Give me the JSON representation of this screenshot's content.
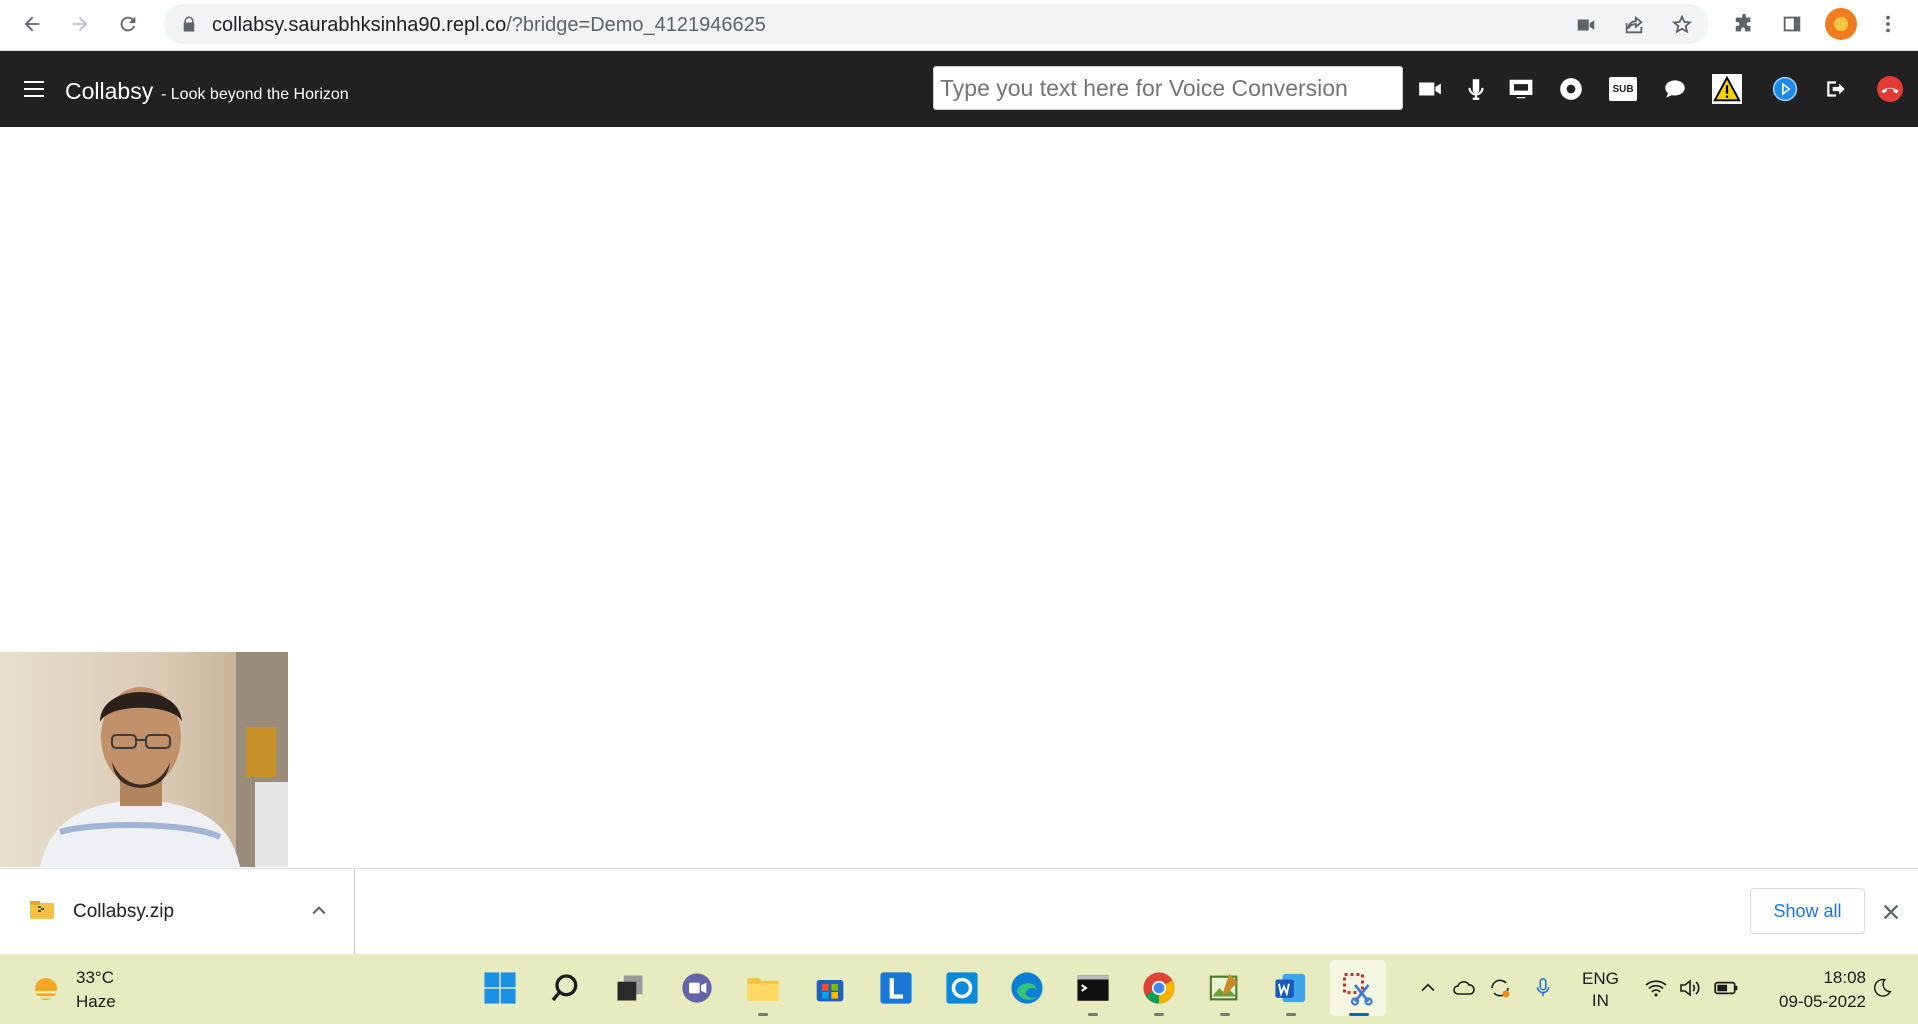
{
  "browser": {
    "url_host": "collabsy.saurabhksinha90.repl.co",
    "url_path": "/?bridge=Demo_4121946625"
  },
  "app": {
    "brand": "Collabsy",
    "tagline": "- Look beyond the Horizon",
    "voice_placeholder": "Type you text here for Voice Conversion",
    "toolbar_icons": [
      "video-camera-icon",
      "microphone-icon",
      "screen-share-icon",
      "record-icon",
      "subtitles-icon",
      "chat-icon",
      "warning-icon",
      "play-icon",
      "leave-icon",
      "end-call-icon"
    ],
    "subtitles_label": "SUB"
  },
  "downloads": {
    "file_name": "Collabsy.zip",
    "show_all": "Show all"
  },
  "taskbar": {
    "temperature": "33°C",
    "weather": "Haze",
    "lang_line1": "ENG",
    "lang_line2": "IN",
    "time": "18:08",
    "date": "09-05-2022"
  }
}
